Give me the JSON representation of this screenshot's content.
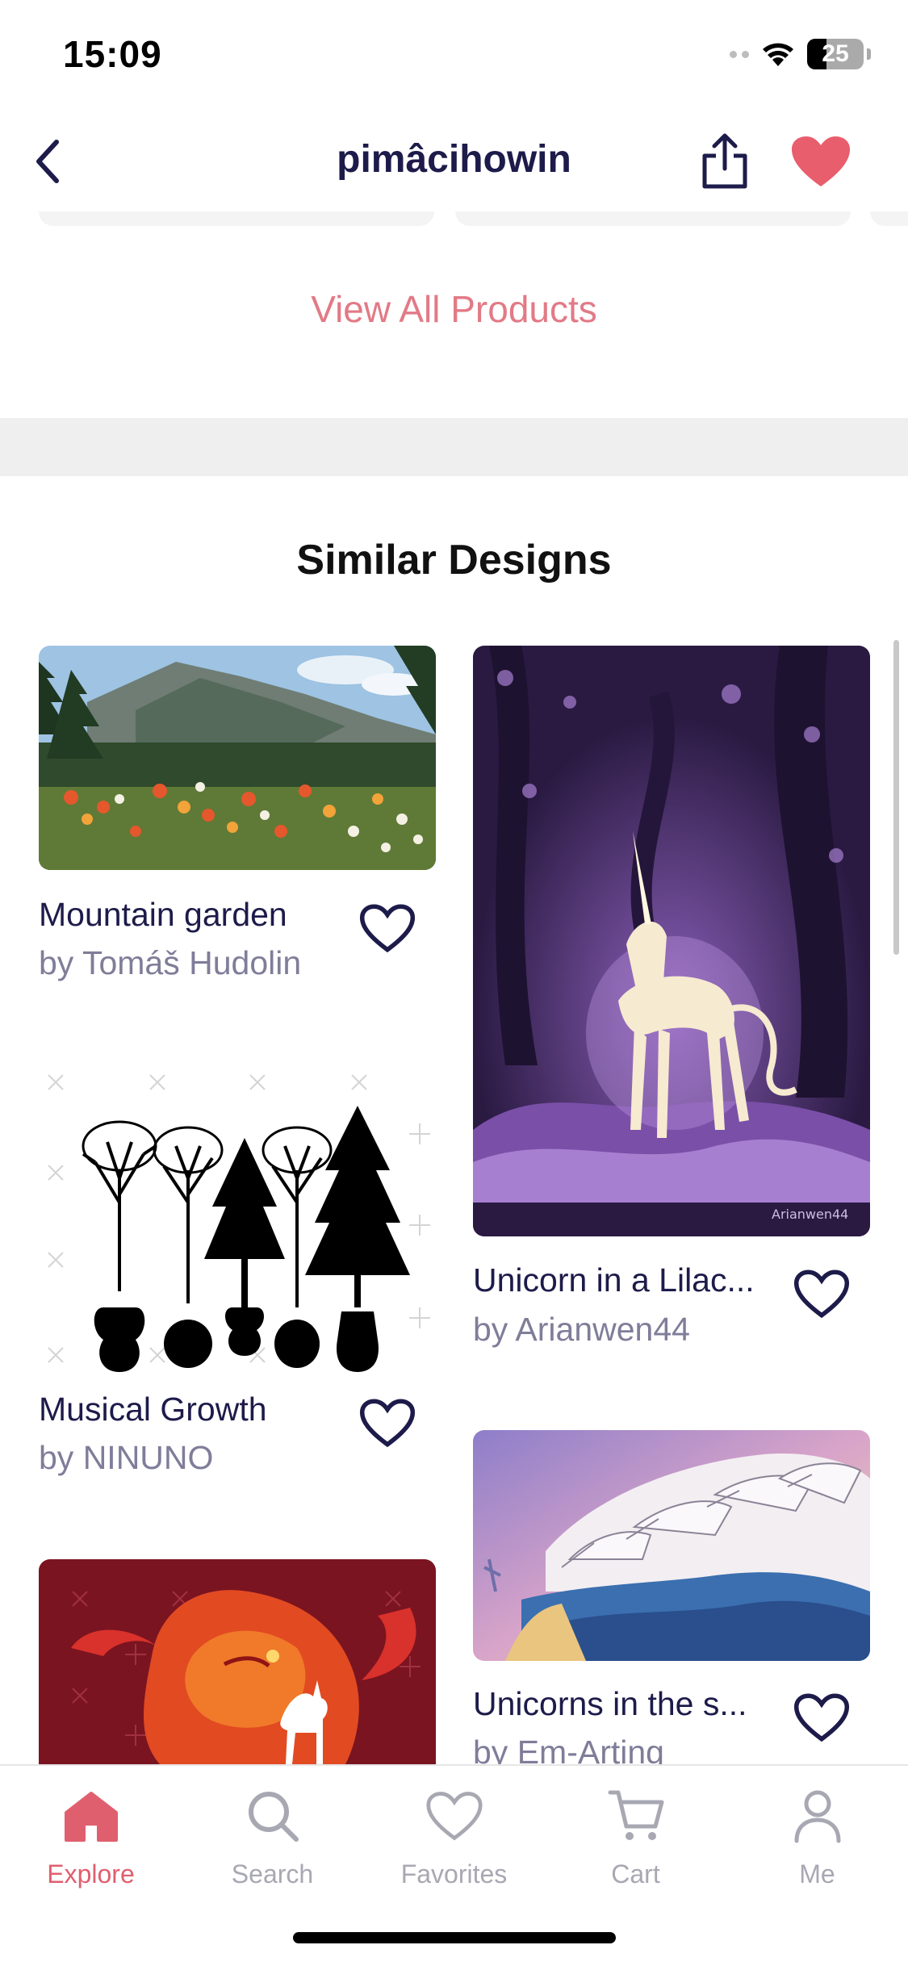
{
  "status": {
    "time": "15:09",
    "battery": "25"
  },
  "nav": {
    "title": "pimâcihowin"
  },
  "view_all_label": "View All Products",
  "section_title": "Similar Designs",
  "designs": [
    {
      "title": "Mountain garden",
      "artist": "by Tomáš Hudolin"
    },
    {
      "title": "Unicorn in a Lilac...",
      "artist": "by Arianwen44",
      "signature": "Arianwen44"
    },
    {
      "title": "Musical Growth",
      "artist": "by NINUNO"
    },
    {
      "title": "Unicorns in the s...",
      "artist": "by Em-Arting"
    }
  ],
  "tabs": [
    {
      "label": "Explore",
      "icon": "home-icon",
      "active": true
    },
    {
      "label": "Search",
      "icon": "search-icon",
      "active": false
    },
    {
      "label": "Favorites",
      "icon": "heart-outline-icon",
      "active": false
    },
    {
      "label": "Cart",
      "icon": "cart-icon",
      "active": false
    },
    {
      "label": "Me",
      "icon": "user-icon",
      "active": false
    }
  ],
  "colors": {
    "accent": "#e05f6f",
    "navy": "#1d1b4a",
    "heart": "#e85e6c",
    "muted": "#7f7d99"
  }
}
